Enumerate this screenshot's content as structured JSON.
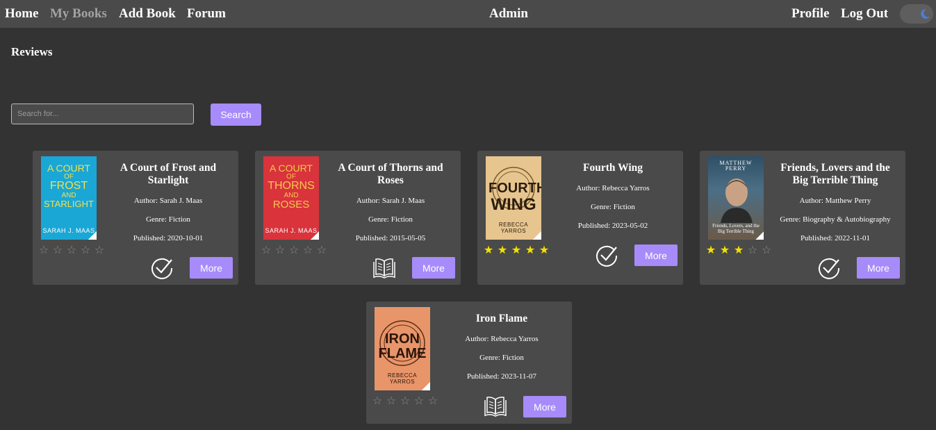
{
  "nav": {
    "home": "Home",
    "my_books": "My Books",
    "add_book": "Add Book",
    "forum": "Forum",
    "user": "Admin",
    "profile": "Profile",
    "logout": "Log Out",
    "theme_toggle_icon": "moon-icon"
  },
  "page": {
    "title": "Reviews"
  },
  "search": {
    "placeholder": "Search for...",
    "value": "",
    "button_label": "Search"
  },
  "colors": {
    "background": "#333333",
    "card": "#4a4a4a",
    "accent": "#a78bfa",
    "star": "#f5e100"
  },
  "books": [
    {
      "title": "A Court of Frost and Starlight",
      "author": "Author: Sarah J. Maas",
      "genre": "Genre: Fiction",
      "published": "Published: 2020-10-01",
      "rating": 0,
      "status_icon": "checkmark-circle-icon",
      "more_label": "More",
      "cover": {
        "title_lines": [
          "A COURT",
          "OF",
          "FROST",
          "AND",
          "STARLIGHT"
        ],
        "author": "SARAH J. MAAS"
      }
    },
    {
      "title": "A Court of Thorns and Roses",
      "author": "Author: Sarah J. Maas",
      "genre": "Genre: Fiction",
      "published": "Published: 2015-05-05",
      "rating": 0,
      "status_icon": "open-book-icon",
      "more_label": "More",
      "cover": {
        "title_lines": [
          "A COURT",
          "OF",
          "THORNS",
          "AND",
          "ROSES"
        ],
        "author": "SARAH J. MAAS"
      }
    },
    {
      "title": "Fourth Wing",
      "author": "Author: Rebecca Yarros",
      "genre": "Genre: Fiction",
      "published": "Published: 2023-05-02",
      "rating": 5,
      "status_icon": "checkmark-circle-icon",
      "more_label": "More",
      "cover": {
        "title_lines": [
          "FOURTH",
          "WING"
        ],
        "author": "REBECCA YARROS"
      }
    },
    {
      "title": "Friends, Lovers and the Big Terrible Thing",
      "author": "Author: Matthew Perry",
      "genre": "Genre: Biography & Autobiography",
      "published": "Published: 2022-11-01",
      "rating": 3,
      "status_icon": "checkmark-circle-icon",
      "more_label": "More",
      "cover": {
        "title_lines": [
          "MATTHEW PERRY"
        ],
        "author": "Friends, Lovers, and the Big Terrible Thing"
      }
    },
    {
      "title": "Iron Flame",
      "author": "Author: Rebecca Yarros",
      "genre": "Genre: Fiction",
      "published": "Published: 2023-11-07",
      "rating": 0,
      "status_icon": "open-book-icon",
      "more_label": "More",
      "cover": {
        "title_lines": [
          "IRON",
          "FLAME"
        ],
        "author": "REBECCA YARROS"
      }
    }
  ]
}
